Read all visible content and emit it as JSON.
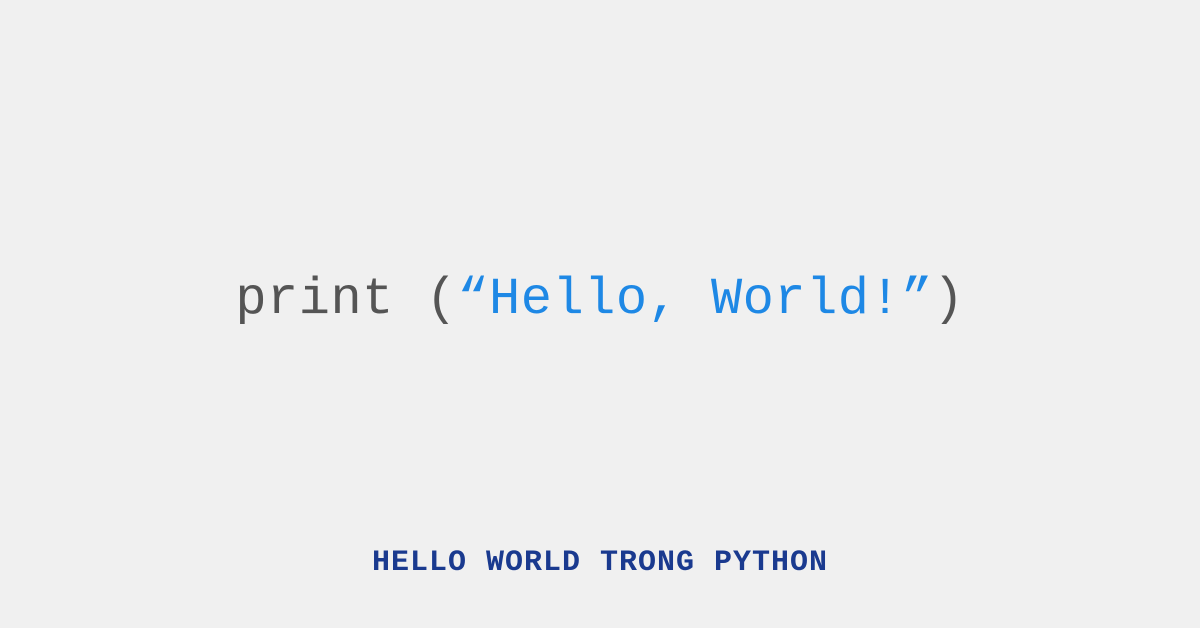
{
  "code": {
    "keyword": "print",
    "space": " ",
    "openParen": "(",
    "stringOpen": "“",
    "stringContent": "Hello, World!",
    "stringClose": "”",
    "closeParen": ")"
  },
  "caption": "HELLO WORLD TRONG PYTHON",
  "colors": {
    "background": "#f0f0f0",
    "codeGray": "#555555",
    "codeBlue": "#1e88e5",
    "captionBlue": "#1a3a8f"
  }
}
